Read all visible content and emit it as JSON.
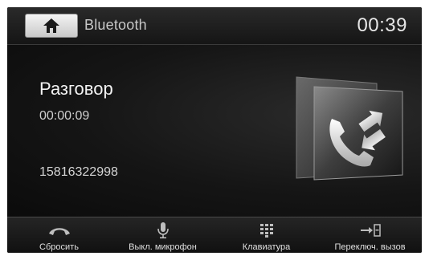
{
  "header": {
    "home_icon": "home-icon",
    "title": "Bluetooth",
    "time": "00:39"
  },
  "call": {
    "status": "Разговор",
    "duration": "00:00:09",
    "number": "15816322998",
    "illustration_icon": "call-transfer-icon"
  },
  "actions": [
    {
      "label": "Сбросить",
      "icon": "hang-up-icon"
    },
    {
      "label": "Выкл. микрофон",
      "icon": "microphone-icon"
    },
    {
      "label": "Клавиатура",
      "icon": "keypad-icon"
    },
    {
      "label": "Переключ. вызов",
      "icon": "switch-call-icon"
    }
  ],
  "colors": {
    "background": "#0c0c0c",
    "text": "#f2f2f2",
    "home_button": "#e6e6e6"
  }
}
